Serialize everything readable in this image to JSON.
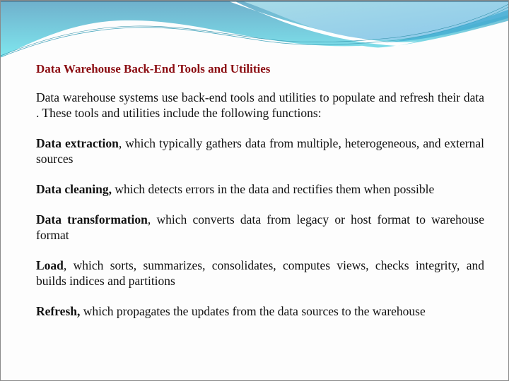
{
  "slide": {
    "title": "Data Warehouse Back-End Tools and Utilities",
    "intro": "Data warehouse systems use back-end tools and utilities to populate and refresh their data . These tools and utilities include the following functions:",
    "functions": [
      {
        "term": "Data extraction",
        "sep": ",",
        "desc": " which typically gathers data from multiple, heterogeneous, and external sources"
      },
      {
        "term": "Data cleaning,",
        "sep": "",
        "desc": " which detects errors in the data and rectifies them when possible"
      },
      {
        "term": "Data transformation",
        "sep": ",",
        "desc": " which converts data from legacy or host format to warehouse format"
      },
      {
        "term": "Load",
        "sep": ",",
        "desc": " which sorts, summarizes, consolidates, computes views, checks integrity, and builds indices and partitions"
      },
      {
        "term": "Refresh,",
        "sep": "",
        "desc": " which propagates the updates from the data sources to the warehouse"
      }
    ],
    "colors": {
      "title": "#8b0d12",
      "wave_dark": "#6fb3cf",
      "wave_light": "#7fe0ea",
      "wave_accent": "#3aa8d0"
    }
  }
}
